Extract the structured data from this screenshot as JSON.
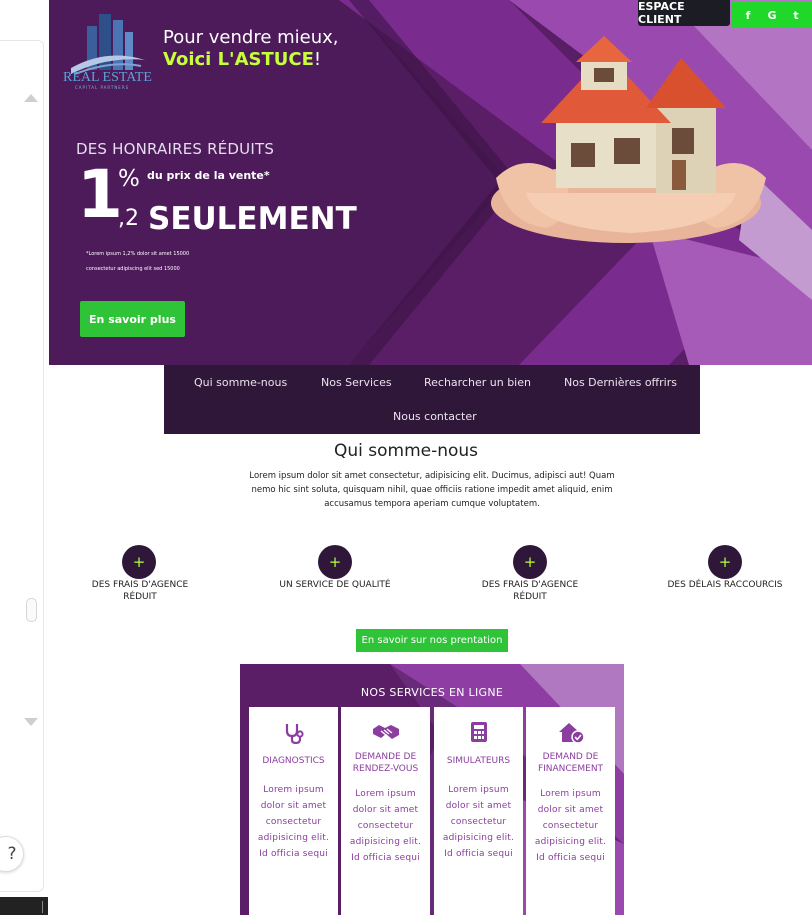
{
  "header": {
    "espace_client": "ESPACE CLIENT",
    "social": [
      {
        "icon": "facebook-icon",
        "glyph": "f"
      },
      {
        "icon": "google-icon",
        "glyph": "G"
      },
      {
        "icon": "twitter-icon",
        "glyph": "t"
      }
    ]
  },
  "hero": {
    "logo_text": "REAL ESTATE",
    "logo_sub": "CAPITAL PARTNERS",
    "tagline_line1": "Pour vendre mieux,",
    "tagline_highlight": "Voici L'ASTUCE",
    "tagline_end": "!",
    "honoraires": "DES HONRAIRES RÉDUITS",
    "big_number": "1",
    "percent_sign": "%",
    "decimal": ",2",
    "prix_vente": "du prix de la vente*",
    "seulement": "SEULEMENT",
    "fine_print_1": "*Lorem ipsum 1,2% dolor sit amet 15000",
    "fine_print_2": "consectetur adipiscing elit sed 15000",
    "cta": "En savoir plus"
  },
  "nav": {
    "items": [
      "Qui somme-nous",
      "Nos Services",
      "Recharcher un bien",
      "Nos Dernières offrirs",
      "Nous contacter"
    ]
  },
  "about": {
    "title": "Qui somme-nous",
    "text": "Lorem ipsum dolor sit amet consectetur, adipisicing elit. Ducimus, adipisci aut! Quam nemo hic sint soluta, quisquam nihil, quae officiis ratione impedit amet aliquid, enim accusamus tempora aperiam cumque voluptatem."
  },
  "features": [
    {
      "icon": "plus-icon",
      "glyph": "+",
      "label": "DES FRAIS D'AGENCE RÉDUIT"
    },
    {
      "icon": "plus-icon",
      "glyph": "+",
      "label": "UN SERVICE DE QUALITÉ"
    },
    {
      "icon": "plus-icon",
      "glyph": "+",
      "label": "DES FRAIS D'AGENCE RÉDUIT"
    },
    {
      "icon": "plus-icon",
      "glyph": "+",
      "label": "DES DÉLAIS RACCOURCIS"
    }
  ],
  "presentation_btn": "En savoir sur nos prentation",
  "services": {
    "title": "NOS SERVICES EN LIGNE",
    "cards": [
      {
        "icon": "stethoscope-icon",
        "title": "DIAGNOSTICS",
        "text": "Lorem ipsum dolor sit amet consectetur adipisicing elit. Id officia sequi"
      },
      {
        "icon": "handshake-icon",
        "title": "DEMANDE DE RENDEZ-VOUS",
        "text": "Lorem ipsum dolor sit amet consectetur adipisicing elit. Id officia sequi"
      },
      {
        "icon": "calculator-icon",
        "title": "SIMULATEURS",
        "text": "Lorem ipsum dolor sit amet consectetur adipisicing elit. Id officia sequi"
      },
      {
        "icon": "house-check-icon",
        "title": "DEMAND DE FINANCEMENT",
        "text": "Lorem ipsum dolor sit amet consectetur adipisicing elit. Id officia sequi"
      }
    ]
  },
  "ui": {
    "help": "?"
  },
  "colors": {
    "purple_dark": "#2e1738",
    "purple_hero": "#5a1e66",
    "green": "#2fc338",
    "lime": "#c8ff3c",
    "card_text": "#8b3da0"
  }
}
